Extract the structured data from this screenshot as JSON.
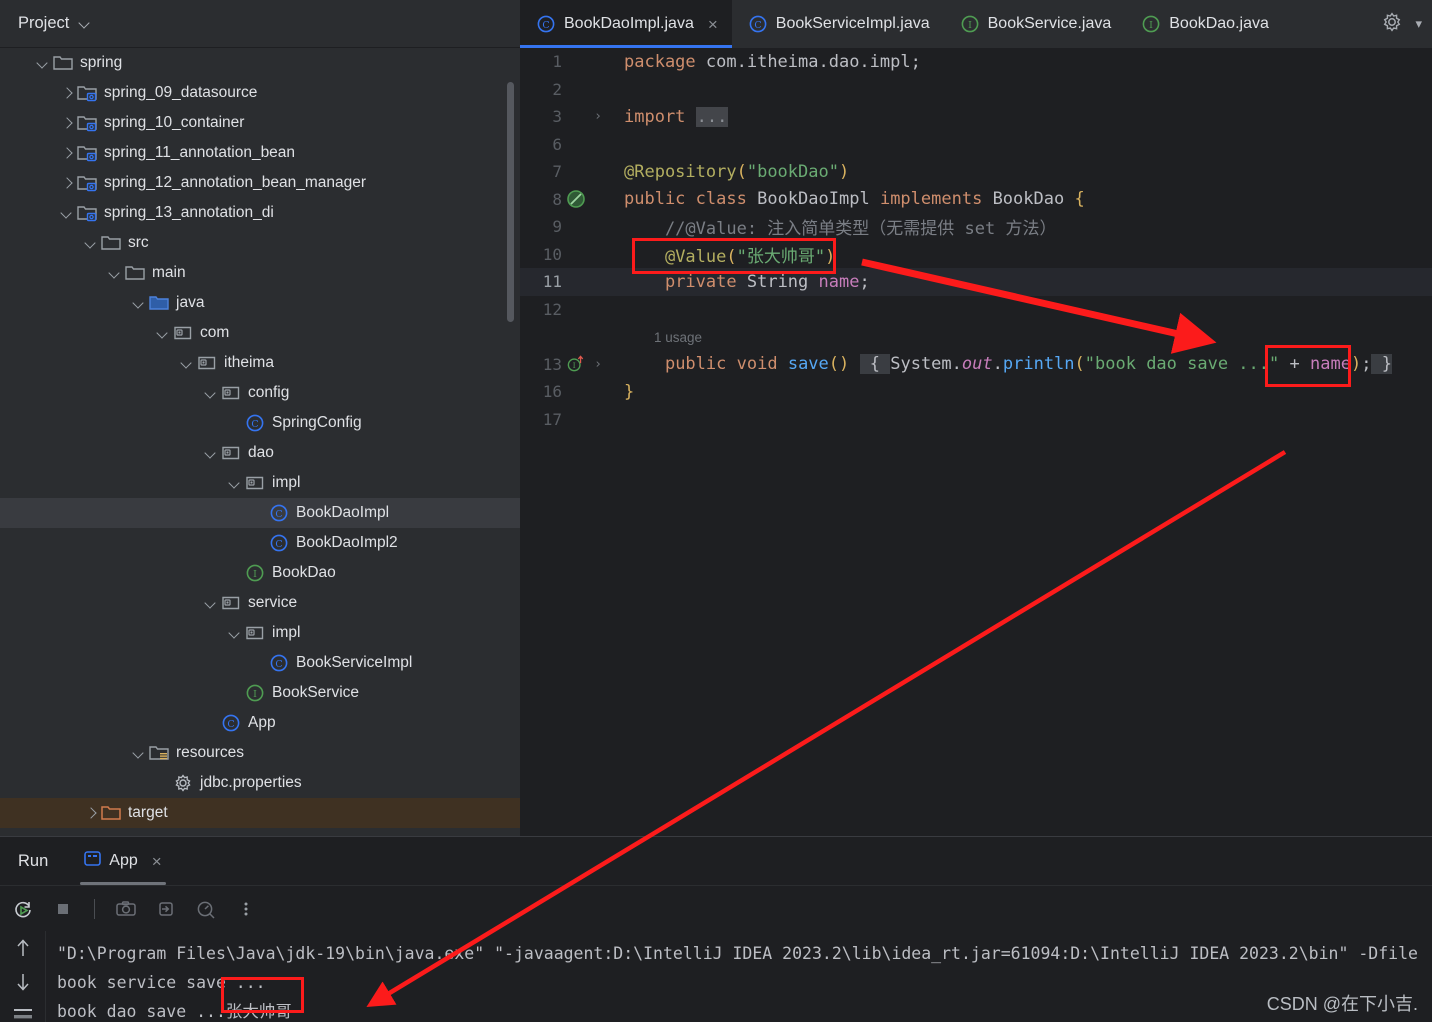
{
  "project": {
    "header_title": "Project",
    "header_chevron_icon": "chevron-down-icon",
    "tree": [
      {
        "label": "spring",
        "indent": 1,
        "arrow": "down",
        "icon": "folder-icon"
      },
      {
        "label": "spring_09_datasource",
        "indent": 2,
        "arrow": "right",
        "icon": "module-folder-icon"
      },
      {
        "label": "spring_10_container",
        "indent": 2,
        "arrow": "right",
        "icon": "module-folder-icon"
      },
      {
        "label": "spring_11_annotation_bean",
        "indent": 2,
        "arrow": "right",
        "icon": "module-folder-icon"
      },
      {
        "label": "spring_12_annotation_bean_manager",
        "indent": 2,
        "arrow": "right",
        "icon": "module-folder-icon"
      },
      {
        "label": "spring_13_annotation_di",
        "indent": 2,
        "arrow": "down",
        "icon": "module-folder-icon"
      },
      {
        "label": "src",
        "indent": 3,
        "arrow": "down",
        "icon": "folder-icon"
      },
      {
        "label": "main",
        "indent": 4,
        "arrow": "down",
        "icon": "folder-icon"
      },
      {
        "label": "java",
        "indent": 5,
        "arrow": "down",
        "icon": "source-root-icon"
      },
      {
        "label": "com",
        "indent": 6,
        "arrow": "down",
        "icon": "package-icon"
      },
      {
        "label": "itheima",
        "indent": 7,
        "arrow": "down",
        "icon": "package-icon"
      },
      {
        "label": "config",
        "indent": 8,
        "arrow": "down",
        "icon": "package-icon"
      },
      {
        "label": "SpringConfig",
        "indent": 9,
        "arrow": "none",
        "icon": "java-class-icon"
      },
      {
        "label": "dao",
        "indent": 8,
        "arrow": "down",
        "icon": "package-icon"
      },
      {
        "label": "impl",
        "indent": 9,
        "arrow": "down",
        "icon": "package-icon"
      },
      {
        "label": "BookDaoImpl",
        "indent": 10,
        "arrow": "none",
        "icon": "java-class-icon",
        "selected": true
      },
      {
        "label": "BookDaoImpl2",
        "indent": 10,
        "arrow": "none",
        "icon": "java-class-icon"
      },
      {
        "label": "BookDao",
        "indent": 9,
        "arrow": "none",
        "icon": "java-interface-icon"
      },
      {
        "label": "service",
        "indent": 8,
        "arrow": "down",
        "icon": "package-icon"
      },
      {
        "label": "impl",
        "indent": 9,
        "arrow": "down",
        "icon": "package-icon"
      },
      {
        "label": "BookServiceImpl",
        "indent": 10,
        "arrow": "none",
        "icon": "java-class-icon"
      },
      {
        "label": "BookService",
        "indent": 9,
        "arrow": "none",
        "icon": "java-interface-icon"
      },
      {
        "label": "App",
        "indent": 8,
        "arrow": "none",
        "icon": "java-class-icon"
      },
      {
        "label": "resources",
        "indent": 5,
        "arrow": "down",
        "icon": "resources-folder-icon"
      },
      {
        "label": "jdbc.properties",
        "indent": 6,
        "arrow": "none",
        "icon": "properties-file-icon"
      },
      {
        "label": "target",
        "indent": 3,
        "arrow": "right",
        "icon": "excluded-folder-icon",
        "excluded": true
      }
    ]
  },
  "editor": {
    "tabs": [
      {
        "label": "BookDaoImpl.java",
        "icon": "java-class-icon",
        "active": true,
        "closable": true
      },
      {
        "label": "BookServiceImpl.java",
        "icon": "java-class-icon",
        "active": false,
        "closable": false
      },
      {
        "label": "BookService.java",
        "icon": "java-interface-icon",
        "active": false,
        "closable": false
      },
      {
        "label": "BookDao.java",
        "icon": "java-interface-icon",
        "active": false,
        "closable": false
      }
    ],
    "close_glyph": "×",
    "gear_icon": "gear-icon",
    "tab_overflow_icon": "chevron-down-icon",
    "lines": [
      {
        "num": "1",
        "text": "package com.itheima.dao.impl;"
      },
      {
        "num": "2",
        "text": ""
      },
      {
        "num": "3",
        "text": "import ...",
        "fold": true
      },
      {
        "num": "6",
        "text": ""
      },
      {
        "num": "7",
        "text": "@Repository(\"bookDao\")"
      },
      {
        "num": "8",
        "text": "public class BookDaoImpl implements BookDao {",
        "gutter_icon": "bean-icon"
      },
      {
        "num": "9",
        "text": "    //@Value: 注入简单类型（无需提供 set 方法）"
      },
      {
        "num": "10",
        "text": "    @Value(\"张大帅哥\")"
      },
      {
        "num": "11",
        "text": "    private String name;",
        "highlighted": true
      },
      {
        "num": "12",
        "text": ""
      },
      {
        "num": "",
        "text": "1 usage",
        "is_hint": true
      },
      {
        "num": "13",
        "text": "    public void save() { System.out.println(\"book dao save ...\" + name); }",
        "gutter_icon": "implements-icon",
        "fold": true
      },
      {
        "num": "16",
        "text": "}"
      },
      {
        "num": "17",
        "text": ""
      }
    ],
    "annotation_value": "张大帅哥",
    "usage_hint": "1 usage"
  },
  "run": {
    "panel_label": "Run",
    "tab_label": "App",
    "tab_icon": "run-config-icon",
    "tab_close_glyph": "×",
    "toolbar": [
      {
        "name": "rerun-icon"
      },
      {
        "name": "stop-icon"
      },
      {
        "name": "camera-icon"
      },
      {
        "name": "thread-dump-icon"
      },
      {
        "name": "profiler-icon"
      },
      {
        "name": "more-options-icon"
      }
    ],
    "side_icons": [
      "scroll-up-icon",
      "scroll-down-icon",
      "soft-wrap-icon"
    ],
    "console_lines": [
      "\"D:\\Program Files\\Java\\jdk-19\\bin\\java.exe\" \"-javaagent:D:\\IntelliJ IDEA 2023.2\\lib\\idea_rt.jar=61094:D:\\IntelliJ IDEA 2023.2\\bin\" -Dfile",
      "book service save ...",
      "book dao save ...张大帅哥"
    ],
    "console_output_value": "张大帅哥"
  },
  "watermark": "CSDN @在下小吉.",
  "colors": {
    "accent_blue": "#3574f0",
    "highlight_red": "#fc1b1b",
    "panel_bg": "#2b2d30",
    "editor_bg": "#1e1f22",
    "selection_bg": "#393b40",
    "excluded_bg": "#3f3122"
  }
}
